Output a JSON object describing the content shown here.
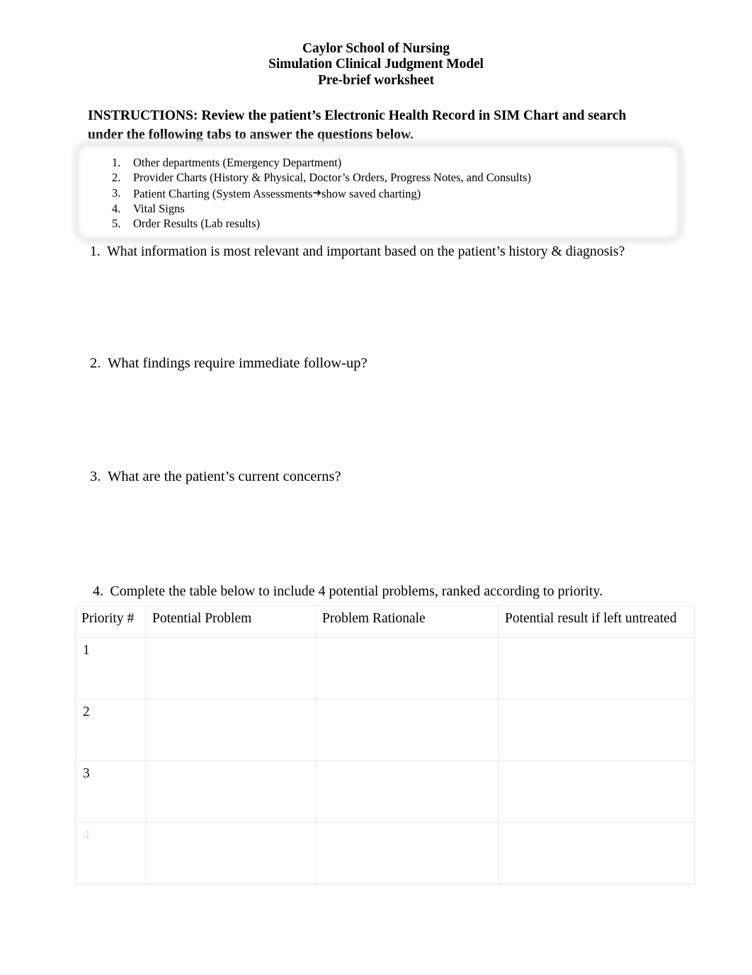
{
  "document": {
    "title_lines": [
      "Caylor School of Nursing",
      "Simulation Clinical Judgment Model",
      "Pre-brief worksheet"
    ],
    "instructions": "INSTRUCTIONS: Review the patient’s Electronic Health Record in SIM Chart and search under the following tabs to answer the questions below."
  },
  "tab_list": {
    "items": [
      {
        "num": "1.",
        "text_before": "Other departments (Emergency Department)",
        "arrow": "",
        "text_after": ""
      },
      {
        "num": "2.",
        "text_before": "Provider Charts (History & Physical, Doctor’s Orders, Progress Notes, and Consults)",
        "arrow": "",
        "text_after": ""
      },
      {
        "num": "3.",
        "text_before": "Patient Charting (System Assessments",
        "arrow": "➔",
        "text_after": "show saved charting)"
      },
      {
        "num": "4.",
        "text_before": "Vital Signs",
        "arrow": "",
        "text_after": ""
      },
      {
        "num": "5.",
        "text_before": "Order Results (Lab results)",
        "arrow": "",
        "text_after": ""
      }
    ]
  },
  "questions": [
    {
      "num": "1.",
      "text": "What information is most relevant and important based on the patient’s history & diagnosis?"
    },
    {
      "num": "2.",
      "text": "What findings require immediate follow-up?"
    },
    {
      "num": "3.",
      "text": "What are the patient’s current concerns?"
    },
    {
      "num": "4.",
      "text": "Complete the table below to include 4 potential problems, ranked according to priority."
    }
  ],
  "table": {
    "headers": [
      "Priority #",
      "Potential Problem",
      "Problem Rationale",
      "Potential result if left untreated"
    ],
    "rows": [
      {
        "priority": "1",
        "potential_problem": "",
        "problem_rationale": "",
        "potential_result": ""
      },
      {
        "priority": "2",
        "potential_problem": "",
        "problem_rationale": "",
        "potential_result": ""
      },
      {
        "priority": "3",
        "potential_problem": "",
        "problem_rationale": "",
        "potential_result": ""
      },
      {
        "priority": "4",
        "potential_problem": "",
        "problem_rationale": "",
        "potential_result": ""
      }
    ]
  },
  "colors": {
    "page_background": "#ffffff",
    "text": "#000000",
    "table_border": "#ececec",
    "faded_text": "#e3e3e3"
  }
}
